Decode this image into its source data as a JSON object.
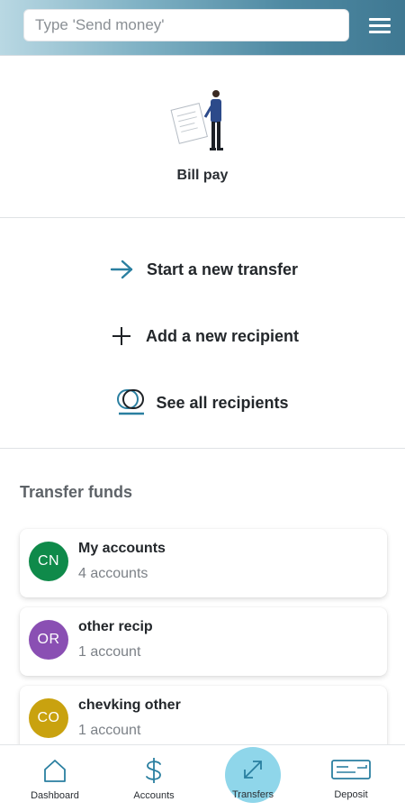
{
  "search": {
    "placeholder": "Type 'Send money'"
  },
  "header": {
    "menu_icon": "hamburger-menu-icon"
  },
  "bill_pay": {
    "label": "Bill pay",
    "icon": "person-with-bill-illustration"
  },
  "actions": [
    {
      "label": "Start a new transfer",
      "icon": "arrow-right-icon"
    },
    {
      "label": "Add a new recipient",
      "icon": "plus-icon"
    },
    {
      "label": "See all recipients",
      "icon": "recipients-coins-icon"
    }
  ],
  "transfer_funds": {
    "title": "Transfer funds",
    "items": [
      {
        "initials": "CN",
        "title": "My accounts",
        "subtitle": "4 accounts",
        "color": "#0f8a4a"
      },
      {
        "initials": "OR",
        "title": "other recip",
        "subtitle": "1 account",
        "color": "#8a4fb3"
      },
      {
        "initials": "CO",
        "title": "chevking other",
        "subtitle": "1 account",
        "color": "#c9a20f"
      }
    ]
  },
  "bottom_nav": {
    "active": "Transfers",
    "active_color": "#8fd6ea",
    "items": [
      {
        "label": "Dashboard",
        "icon": "home-icon"
      },
      {
        "label": "Accounts",
        "icon": "dollar-icon"
      },
      {
        "label": "Transfers",
        "icon": "transfer-arrows-icon"
      },
      {
        "label": "Deposit",
        "icon": "check-deposit-icon"
      }
    ]
  }
}
